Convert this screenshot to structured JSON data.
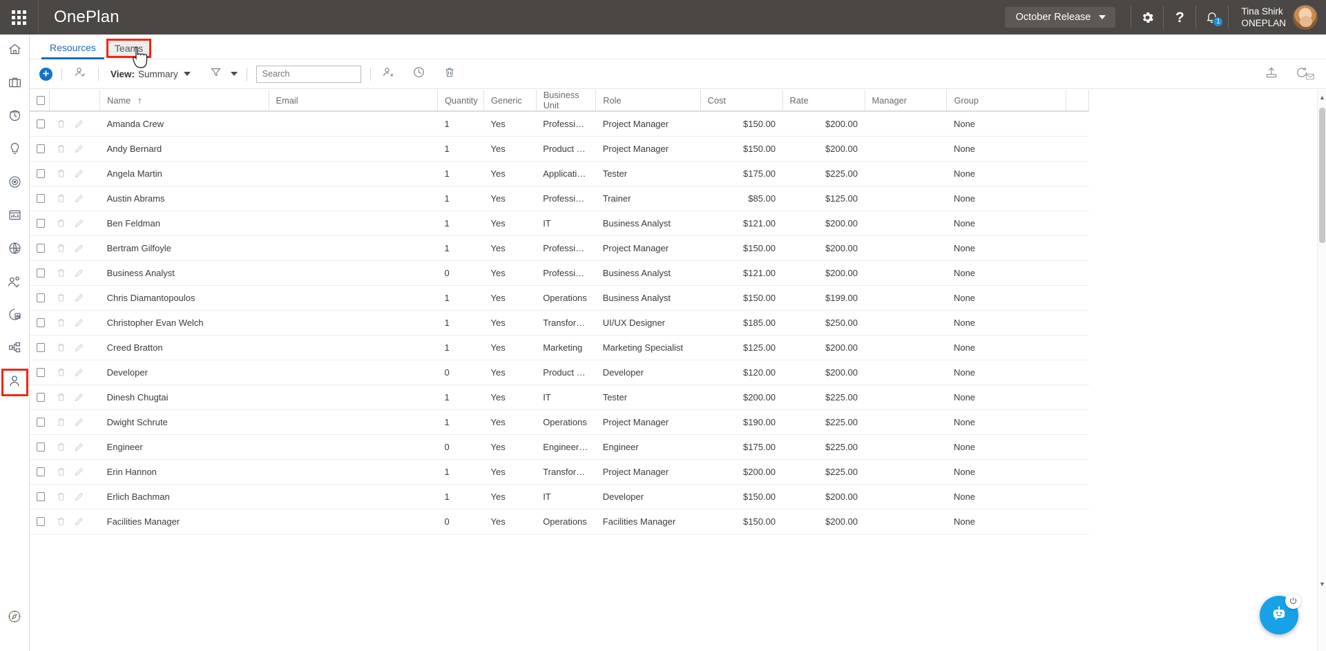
{
  "header": {
    "waffle_icon": "app-launcher-icon",
    "brand": "OnePlan",
    "release": {
      "label": "October Release",
      "icon": "chevron-down-icon"
    },
    "settings_icon": "gear-icon",
    "help_icon": "question-mark-icon",
    "help_label": "?",
    "notifications_icon": "bell-icon",
    "notification_count": "1",
    "user": {
      "name": "Tina Shirk",
      "org": "ONEPLAN",
      "avatar": "avatar"
    }
  },
  "sidebar": {
    "items": [
      {
        "name": "home",
        "icon": "home-icon"
      },
      {
        "name": "portfolio",
        "icon": "briefcase-icon"
      },
      {
        "name": "timesheets",
        "icon": "clock-icon"
      },
      {
        "name": "ideas",
        "icon": "lightbulb-icon"
      },
      {
        "name": "goals",
        "icon": "target-icon"
      },
      {
        "name": "reports",
        "icon": "bar-chart-icon"
      },
      {
        "name": "integrations",
        "icon": "globe-arrow-icon"
      },
      {
        "name": "teams",
        "icon": "people-check-icon"
      },
      {
        "name": "analytics",
        "icon": "pie-chart-icon"
      },
      {
        "name": "workflows",
        "icon": "sitemap-icon"
      },
      {
        "name": "resources",
        "icon": "person-icon"
      }
    ],
    "bottom_item": {
      "name": "explore",
      "icon": "compass-icon"
    }
  },
  "tabs": [
    {
      "label": "Resources",
      "state": "active"
    },
    {
      "label": "Teams",
      "state": "highlighted"
    }
  ],
  "toolbar": {
    "add_icon": "plus-circle-icon",
    "add_label": "+",
    "assign_resource_icon": "person-check-icon",
    "view_label": "View:",
    "view_value": "Summary",
    "view_caret_icon": "chevron-down-icon",
    "filter_icon": "funnel-icon",
    "filter_caret_icon": "chevron-down-icon",
    "search_placeholder": "Search",
    "search_value": "",
    "remove_resource_icon": "person-remove-icon",
    "history_icon": "clock-history-icon",
    "delete_icon": "trash-icon",
    "export_icon": "export-upload-icon",
    "refresh_icon": "refresh-icon"
  },
  "grid": {
    "select_all_checkbox": "unchecked",
    "sort_column": "Name",
    "sort_direction_icon": "sort-ascending-icon",
    "columns": [
      {
        "key": "name",
        "label": "Name",
        "align": "left"
      },
      {
        "key": "email",
        "label": "Email",
        "align": "left"
      },
      {
        "key": "quantity",
        "label": "Quantity",
        "align": "left"
      },
      {
        "key": "generic",
        "label": "Generic",
        "align": "left"
      },
      {
        "key": "business_unit",
        "label": "Business Unit",
        "align": "left"
      },
      {
        "key": "role",
        "label": "Role",
        "align": "left"
      },
      {
        "key": "cost",
        "label": "Cost",
        "align": "right"
      },
      {
        "key": "rate",
        "label": "Rate",
        "align": "right"
      },
      {
        "key": "manager",
        "label": "Manager",
        "align": "left"
      },
      {
        "key": "group",
        "label": "Group",
        "align": "left"
      }
    ],
    "rows": [
      {
        "name": "Amanda Crew",
        "email": "",
        "quantity": "1",
        "generic": "Yes",
        "business_unit": "Professional Services",
        "role": "Project Manager",
        "cost": "$150.00",
        "rate": "$200.00",
        "manager": "",
        "group": "None"
      },
      {
        "name": "Andy Bernard",
        "email": "",
        "quantity": "1",
        "generic": "Yes",
        "business_unit": "Product Developm...",
        "role": "Project Manager",
        "cost": "$150.00",
        "rate": "$200.00",
        "manager": "",
        "group": "None"
      },
      {
        "name": "Angela Martin",
        "email": "",
        "quantity": "1",
        "generic": "Yes",
        "business_unit": "Applications",
        "role": "Tester",
        "cost": "$175.00",
        "rate": "$225.00",
        "manager": "",
        "group": "None"
      },
      {
        "name": "Austin Abrams",
        "email": "",
        "quantity": "1",
        "generic": "Yes",
        "business_unit": "Professional Services",
        "role": "Trainer",
        "cost": "$85.00",
        "rate": "$125.00",
        "manager": "",
        "group": "None"
      },
      {
        "name": "Ben Feldman",
        "email": "",
        "quantity": "1",
        "generic": "Yes",
        "business_unit": "IT",
        "role": "Business Analyst",
        "cost": "$121.00",
        "rate": "$200.00",
        "manager": "",
        "group": "None"
      },
      {
        "name": "Bertram Gilfoyle",
        "email": "",
        "quantity": "1",
        "generic": "Yes",
        "business_unit": "Professional Services",
        "role": "Project Manager",
        "cost": "$150.00",
        "rate": "$200.00",
        "manager": "",
        "group": "None"
      },
      {
        "name": "Business Analyst",
        "email": "",
        "quantity": "0",
        "generic": "Yes",
        "business_unit": "Professional Services",
        "role": "Business Analyst",
        "cost": "$121.00",
        "rate": "$200.00",
        "manager": "",
        "group": "None"
      },
      {
        "name": "Chris Diamantopoulos",
        "email": "",
        "quantity": "1",
        "generic": "Yes",
        "business_unit": "Operations",
        "role": "Business Analyst",
        "cost": "$150.00",
        "rate": "$199.00",
        "manager": "",
        "group": "None"
      },
      {
        "name": "Christopher Evan Welch",
        "email": "",
        "quantity": "1",
        "generic": "Yes",
        "business_unit": "Transformation",
        "role": "UI/UX Designer",
        "cost": "$185.00",
        "rate": "$250.00",
        "manager": "",
        "group": "None"
      },
      {
        "name": "Creed Bratton",
        "email": "",
        "quantity": "1",
        "generic": "Yes",
        "business_unit": "Marketing",
        "role": "Marketing Specialist",
        "cost": "$125.00",
        "rate": "$200.00",
        "manager": "",
        "group": "None"
      },
      {
        "name": "Developer",
        "email": "",
        "quantity": "0",
        "generic": "Yes",
        "business_unit": "Product Developm...",
        "role": "Developer",
        "cost": "$120.00",
        "rate": "$200.00",
        "manager": "",
        "group": "None"
      },
      {
        "name": "Dinesh Chugtai",
        "email": "",
        "quantity": "1",
        "generic": "Yes",
        "business_unit": "IT",
        "role": "Tester",
        "cost": "$200.00",
        "rate": "$225.00",
        "manager": "",
        "group": "None"
      },
      {
        "name": "Dwight Schrute",
        "email": "",
        "quantity": "1",
        "generic": "Yes",
        "business_unit": "Operations",
        "role": "Project Manager",
        "cost": "$190.00",
        "rate": "$225.00",
        "manager": "",
        "group": "None"
      },
      {
        "name": "Engineer",
        "email": "",
        "quantity": "0",
        "generic": "Yes",
        "business_unit": "Engineering",
        "role": "Engineer",
        "cost": "$175.00",
        "rate": "$225.00",
        "manager": "",
        "group": "None"
      },
      {
        "name": "Erin Hannon",
        "email": "",
        "quantity": "1",
        "generic": "Yes",
        "business_unit": "Transformation",
        "role": "Project Manager",
        "cost": "$200.00",
        "rate": "$225.00",
        "manager": "",
        "group": "None"
      },
      {
        "name": "Erlich Bachman",
        "email": "",
        "quantity": "1",
        "generic": "Yes",
        "business_unit": "IT",
        "role": "Developer",
        "cost": "$150.00",
        "rate": "$200.00",
        "manager": "",
        "group": "None"
      },
      {
        "name": "Facilities Manager",
        "email": "",
        "quantity": "0",
        "generic": "Yes",
        "business_unit": "Operations",
        "role": "Facilities Manager",
        "cost": "$150.00",
        "rate": "$200.00",
        "manager": "",
        "group": "None"
      }
    ],
    "row_action_icons": {
      "delete": "trash-icon",
      "edit": "pencil-icon"
    }
  },
  "chat": {
    "fab_icon": "chat-bot-icon",
    "power_icon": "power-icon"
  },
  "colors": {
    "accent": "#1273c7",
    "header_bg": "#4a4744",
    "highlight": "#f22613",
    "fab": "#17a1e6"
  }
}
